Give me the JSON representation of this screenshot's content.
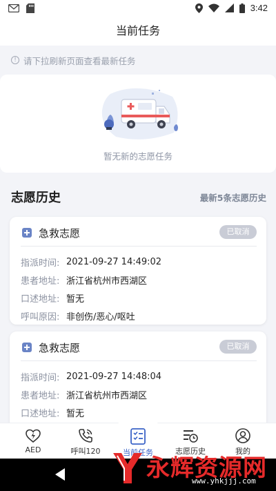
{
  "status_bar": {
    "time": "3:42"
  },
  "header": {
    "title": "当前任务"
  },
  "notice": {
    "text": "请下拉刷新页面查看最新任务"
  },
  "empty_state": {
    "text": "暂无新的志愿任务"
  },
  "history": {
    "title": "志愿历史",
    "link": "最新5条志愿历史",
    "cards": [
      {
        "type": "急救志愿",
        "status": "已取消",
        "rows": [
          {
            "label": "指派时间:",
            "value": "2021-09-27 14:49:02"
          },
          {
            "label": "患者地址:",
            "value": "浙江省杭州市西湖区"
          },
          {
            "label": "口述地址:",
            "value": "暂无"
          },
          {
            "label": "呼叫原因:",
            "value": "非创伤/恶心/呕吐"
          }
        ]
      },
      {
        "type": "急救志愿",
        "status": "已取消",
        "rows": [
          {
            "label": "指派时间:",
            "value": "2021-09-27 14:48:04"
          },
          {
            "label": "患者地址:",
            "value": "浙江省杭州市西湖区"
          },
          {
            "label": "口述地址:",
            "value": "暂无"
          }
        ]
      }
    ]
  },
  "tabs": [
    {
      "label": "AED",
      "icon": "heart-bolt-icon"
    },
    {
      "label": "呼叫120",
      "icon": "phone-call-icon"
    },
    {
      "label": "当前任务",
      "icon": "checklist-icon",
      "active": true
    },
    {
      "label": "志愿历史",
      "icon": "history-list-icon"
    },
    {
      "label": "我的",
      "icon": "user-icon"
    }
  ],
  "colors": {
    "accent": "#3a63c7",
    "badge": "#c9ccd6",
    "watermark_red": "#e52a2a"
  },
  "watermark": {
    "title": "永辉资源网",
    "url": "www.yhkjjj.com"
  }
}
